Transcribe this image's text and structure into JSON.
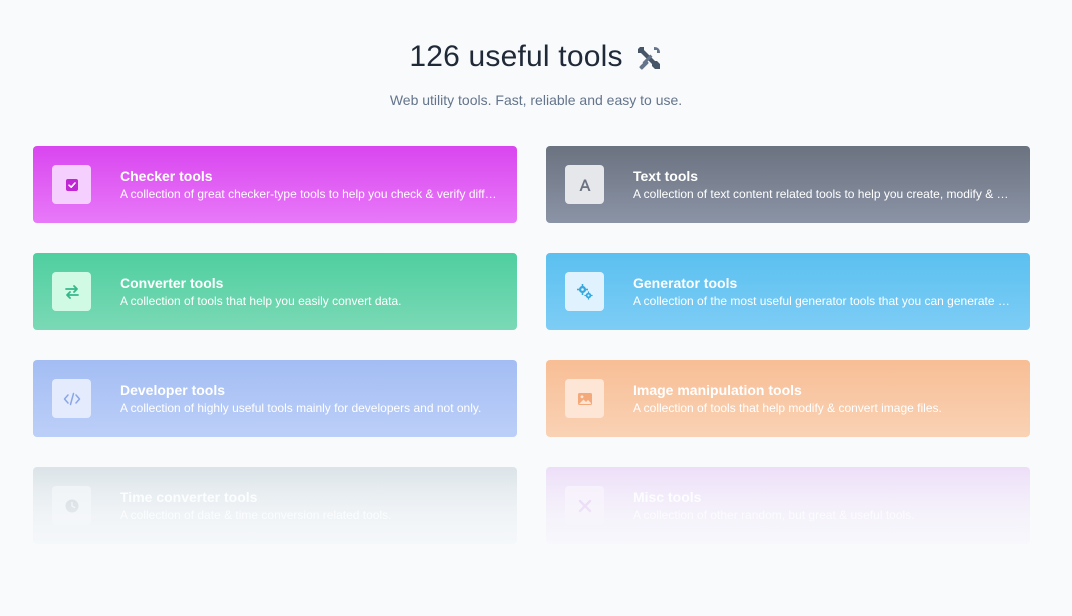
{
  "header": {
    "title": "126 useful tools",
    "title_icon": "wrench-screwdriver-icon",
    "subtitle": "Web utility tools. Fast, reliable and easy to use."
  },
  "cards": [
    {
      "key": "checker",
      "title": "Checker tools",
      "description": "A collection of great checker-type tools to help you check & verify different things.",
      "icon": "check-square-icon",
      "color": "#d946ef"
    },
    {
      "key": "text",
      "title": "Text tools",
      "description": "A collection of text content related tools to help you create, modify & improve text types.",
      "icon": "letter-a-icon",
      "color": "#6b7280"
    },
    {
      "key": "converter",
      "title": "Converter tools",
      "description": "A collection of tools that help you easily convert data.",
      "icon": "arrows-exchange-icon",
      "color": "#4fcfa0"
    },
    {
      "key": "generator",
      "title": "Generator tools",
      "description": "A collection of the most useful generator tools that you can generate data with.",
      "icon": "gears-icon",
      "color": "#5bc0f0"
    },
    {
      "key": "developer",
      "title": "Developer tools",
      "description": "A collection of highly useful tools mainly for developers and not only.",
      "icon": "code-icon",
      "color": "#a3bdf3"
    },
    {
      "key": "image",
      "title": "Image manipulation tools",
      "description": "A collection of tools that help modify & convert image files.",
      "icon": "image-icon",
      "color": "#f8be95"
    },
    {
      "key": "time",
      "title": "Time converter tools",
      "description": "A collection of date & time conversion related tools.",
      "icon": "clock-icon",
      "color": "#d9e2e7"
    },
    {
      "key": "misc",
      "title": "Misc tools",
      "description": "A collection of other random, but great & useful tools.",
      "icon": "tools-icon",
      "color": "#ecdcf8"
    }
  ]
}
